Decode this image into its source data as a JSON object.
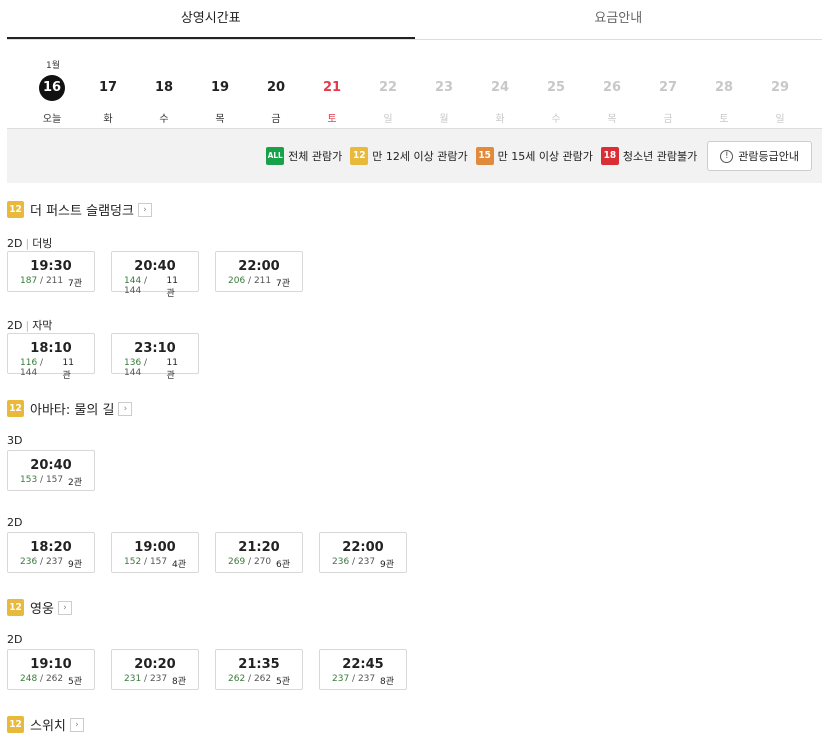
{
  "tabs": [
    {
      "label": "상영시간표"
    },
    {
      "label": "요금안내"
    }
  ],
  "month_label": "1월",
  "dates": [
    {
      "num": "16",
      "dow": "오늘",
      "state": "selected"
    },
    {
      "num": "17",
      "dow": "화",
      "state": "normal"
    },
    {
      "num": "18",
      "dow": "수",
      "state": "normal"
    },
    {
      "num": "19",
      "dow": "목",
      "state": "normal"
    },
    {
      "num": "20",
      "dow": "금",
      "state": "normal"
    },
    {
      "num": "21",
      "dow": "토",
      "state": "sat"
    },
    {
      "num": "22",
      "dow": "일",
      "state": "disabled"
    },
    {
      "num": "23",
      "dow": "월",
      "state": "disabled"
    },
    {
      "num": "24",
      "dow": "화",
      "state": "disabled"
    },
    {
      "num": "25",
      "dow": "수",
      "state": "disabled"
    },
    {
      "num": "26",
      "dow": "목",
      "state": "disabled"
    },
    {
      "num": "27",
      "dow": "금",
      "state": "disabled"
    },
    {
      "num": "28",
      "dow": "토",
      "state": "disabled"
    },
    {
      "num": "29",
      "dow": "일",
      "state": "disabled"
    }
  ],
  "ratings": [
    {
      "badge": "ALL",
      "label": "전체 관람가",
      "color": "#17a24a"
    },
    {
      "badge": "12",
      "label": "만 12세 이상 관람가",
      "color": "#e8b93a"
    },
    {
      "badge": "15",
      "label": "만 15세 이상 관람가",
      "color": "#e28a3b"
    },
    {
      "badge": "18",
      "label": "청소년 관람불가",
      "color": "#d92e36"
    }
  ],
  "rating_guide_label": "관람등급안내",
  "movies": [
    {
      "title": "더 퍼스트 슬램덩크",
      "rating": "12",
      "formats": [
        {
          "format": "2D",
          "sub": "더빙",
          "shows": [
            {
              "time": "19:30",
              "avail": "187",
              "total": "211",
              "hall": "7관"
            },
            {
              "time": "20:40",
              "avail": "144",
              "total": "144",
              "hall": "11관"
            },
            {
              "time": "22:00",
              "avail": "206",
              "total": "211",
              "hall": "7관"
            }
          ]
        },
        {
          "format": "2D",
          "sub": "자막",
          "shows": [
            {
              "time": "18:10",
              "avail": "116",
              "total": "144",
              "hall": "11관"
            },
            {
              "time": "23:10",
              "avail": "136",
              "total": "144",
              "hall": "11관"
            }
          ]
        }
      ]
    },
    {
      "title": "아바타: 물의 길",
      "rating": "12",
      "formats": [
        {
          "format": "3D",
          "sub": "",
          "shows": [
            {
              "time": "20:40",
              "avail": "153",
              "total": "157",
              "hall": "2관"
            }
          ]
        },
        {
          "format": "2D",
          "sub": "",
          "shows": [
            {
              "time": "18:20",
              "avail": "236",
              "total": "237",
              "hall": "9관"
            },
            {
              "time": "19:00",
              "avail": "152",
              "total": "157",
              "hall": "4관"
            },
            {
              "time": "21:20",
              "avail": "269",
              "total": "270",
              "hall": "6관"
            },
            {
              "time": "22:00",
              "avail": "236",
              "total": "237",
              "hall": "9관"
            }
          ]
        }
      ]
    },
    {
      "title": "영웅",
      "rating": "12",
      "formats": [
        {
          "format": "2D",
          "sub": "",
          "shows": [
            {
              "time": "19:10",
              "avail": "248",
              "total": "262",
              "hall": "5관"
            },
            {
              "time": "20:20",
              "avail": "231",
              "total": "237",
              "hall": "8관"
            },
            {
              "time": "21:35",
              "avail": "262",
              "total": "262",
              "hall": "5관"
            },
            {
              "time": "22:45",
              "avail": "237",
              "total": "237",
              "hall": "8관"
            }
          ]
        }
      ]
    },
    {
      "title": "스위치",
      "rating": "12",
      "formats": []
    }
  ]
}
